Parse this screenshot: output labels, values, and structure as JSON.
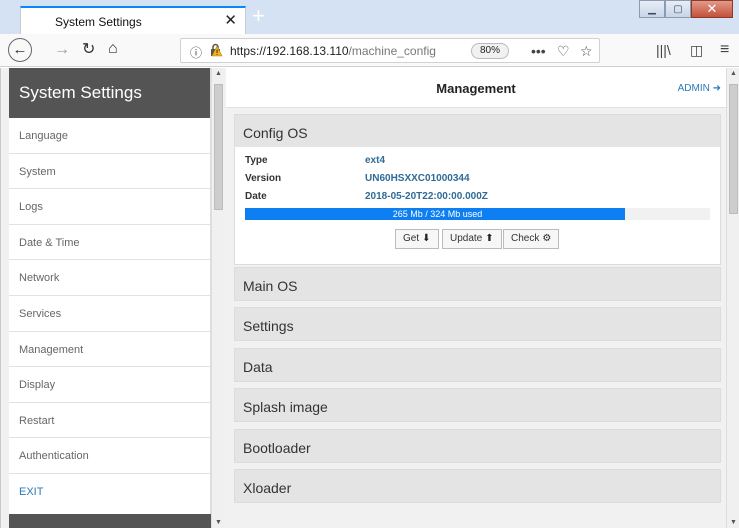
{
  "browser": {
    "tab_title": "System Settings",
    "tab_close": "✕",
    "new_tab": "+",
    "url_host": "https://192.168.13.110",
    "url_path": "/machine_config",
    "zoom": "80%",
    "page_actions": "•••"
  },
  "sidebar": {
    "title": "System Settings",
    "items": [
      {
        "label": "Language"
      },
      {
        "label": "System"
      },
      {
        "label": "Logs"
      },
      {
        "label": "Date & Time"
      },
      {
        "label": "Network"
      },
      {
        "label": "Services"
      },
      {
        "label": "Management"
      },
      {
        "label": "Display"
      },
      {
        "label": "Restart"
      },
      {
        "label": "Authentication"
      },
      {
        "label": "EXIT"
      }
    ]
  },
  "main": {
    "title": "Management",
    "admin_label": "ADMIN",
    "config_os": {
      "title": "Config OS",
      "type_label": "Type",
      "type_value": "ext4",
      "version_label": "Version",
      "version_value": "UN60HSXXC01000344",
      "date_label": "Date",
      "date_value": "2018-05-20T22:00:00.000Z",
      "usage_text": "265 Mb / 324 Mb used",
      "usage_fraction": 0.818,
      "get_label": "Get",
      "update_label": "Update",
      "check_label": "Check"
    },
    "sections": [
      {
        "title": "Main OS"
      },
      {
        "title": "Settings"
      },
      {
        "title": "Data"
      },
      {
        "title": "Splash image"
      },
      {
        "title": "Bootloader"
      },
      {
        "title": "Xloader"
      }
    ]
  },
  "colors": {
    "accent": "#0d7ff3",
    "sidebar_header": "#545454",
    "link": "#2b7ab8"
  }
}
